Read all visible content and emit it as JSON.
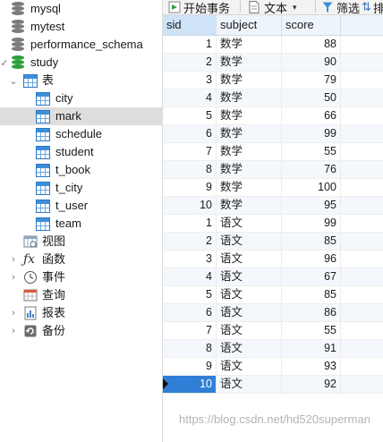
{
  "navigator": {
    "databases": [
      {
        "name": "mysql"
      },
      {
        "name": "mytest"
      },
      {
        "name": "performance_schema"
      },
      {
        "name": "study"
      }
    ],
    "tables_group": "表",
    "tables": [
      "city",
      "mark",
      "schedule",
      "student",
      "t_book",
      "t_city",
      "t_user",
      "team"
    ],
    "selected_table": "mark",
    "other_groups": [
      "视图",
      "函数",
      "事件",
      "查询",
      "报表",
      "备份"
    ]
  },
  "toolbar": {
    "begin_transaction": "开始事务",
    "text": "文本",
    "filter": "筛选",
    "sort": "排"
  },
  "grid": {
    "columns": [
      "sid",
      "subject",
      "score"
    ],
    "rows": [
      {
        "sid": "1",
        "subject": "数学",
        "score": "88"
      },
      {
        "sid": "2",
        "subject": "数学",
        "score": "90"
      },
      {
        "sid": "3",
        "subject": "数学",
        "score": "79"
      },
      {
        "sid": "4",
        "subject": "数学",
        "score": "50"
      },
      {
        "sid": "5",
        "subject": "数学",
        "score": "66"
      },
      {
        "sid": "6",
        "subject": "数学",
        "score": "99"
      },
      {
        "sid": "7",
        "subject": "数学",
        "score": "55"
      },
      {
        "sid": "8",
        "subject": "数学",
        "score": "76"
      },
      {
        "sid": "9",
        "subject": "数学",
        "score": "100"
      },
      {
        "sid": "10",
        "subject": "数学",
        "score": "95"
      },
      {
        "sid": "1",
        "subject": "语文",
        "score": "99"
      },
      {
        "sid": "2",
        "subject": "语文",
        "score": "85"
      },
      {
        "sid": "3",
        "subject": "语文",
        "score": "96"
      },
      {
        "sid": "4",
        "subject": "语文",
        "score": "67"
      },
      {
        "sid": "5",
        "subject": "语文",
        "score": "85"
      },
      {
        "sid": "6",
        "subject": "语文",
        "score": "86"
      },
      {
        "sid": "7",
        "subject": "语文",
        "score": "55"
      },
      {
        "sid": "8",
        "subject": "语文",
        "score": "91"
      },
      {
        "sid": "9",
        "subject": "语文",
        "score": "93"
      },
      {
        "sid": "10",
        "subject": "语文",
        "score": "92"
      }
    ]
  },
  "watermark": "https://blog.csdn.net/hd520superman",
  "colors": {
    "selection": "#2f7fd6",
    "header_bg": "#eef4fb",
    "db_active": "#2e9e3a"
  }
}
